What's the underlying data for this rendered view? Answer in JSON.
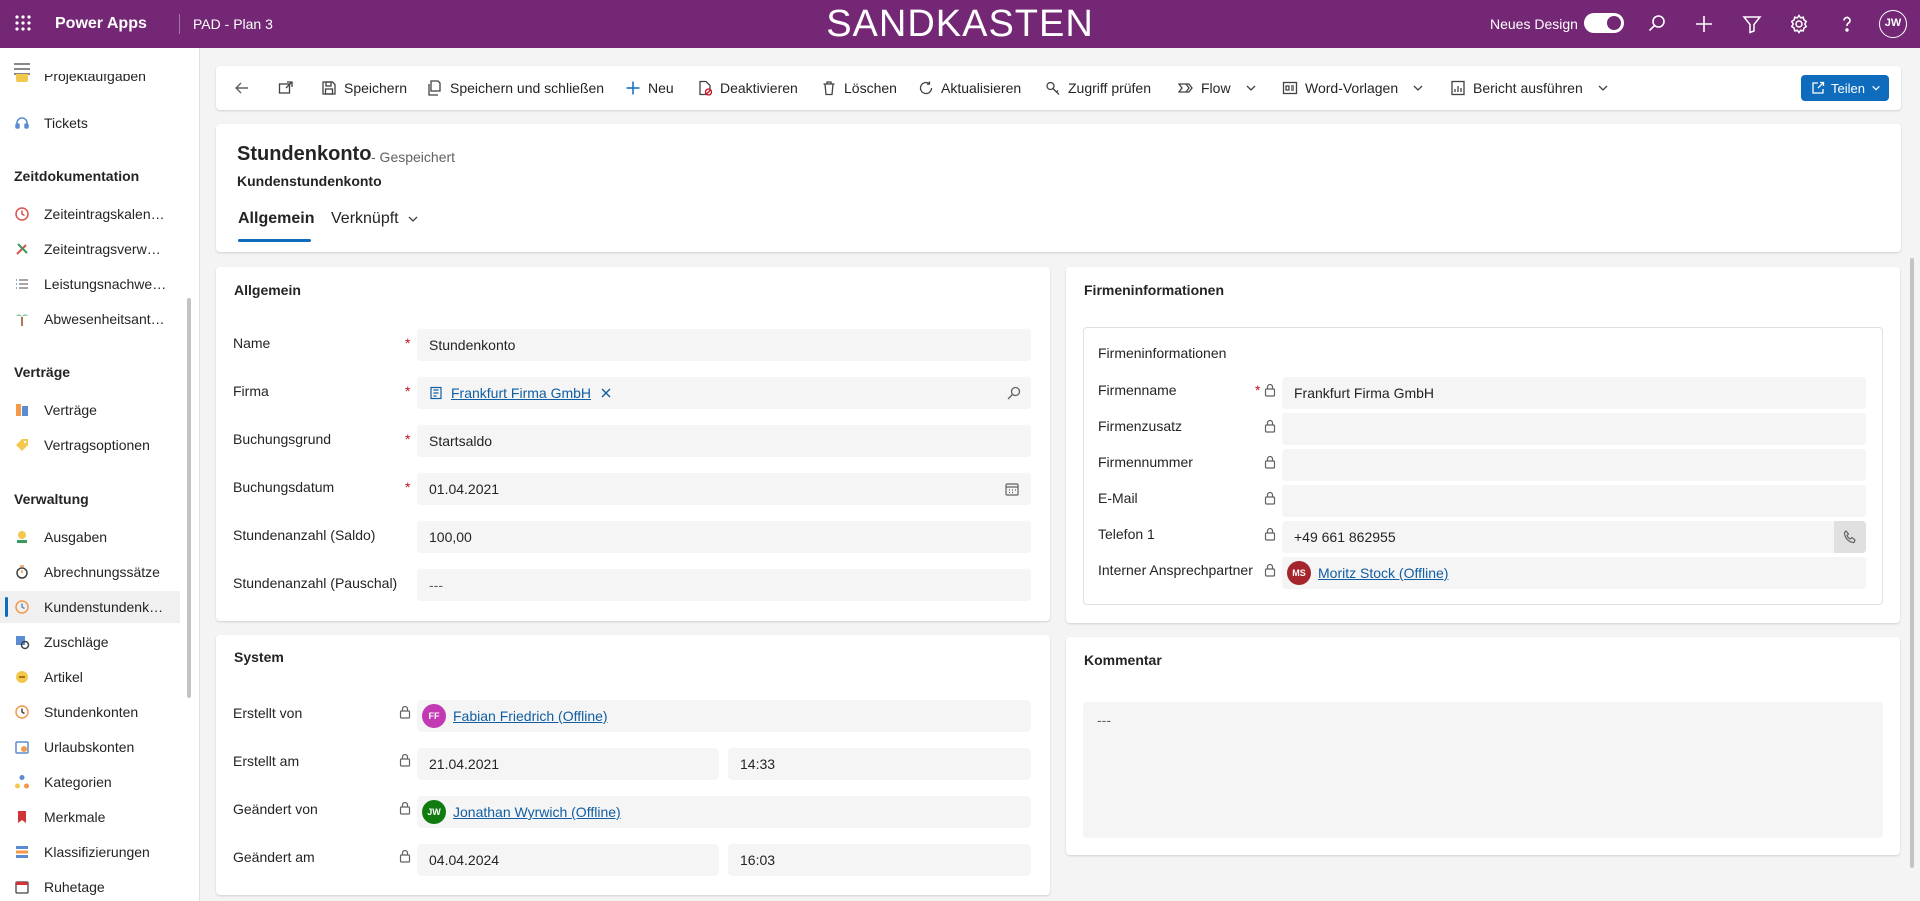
{
  "topbar": {
    "app_name": "Power Apps",
    "env_name": "PAD - Plan 3",
    "banner": "SANDKASTEN",
    "new_design_label": "Neues Design",
    "avatar": "JW"
  },
  "sidebar": {
    "partial_item": "Projektaufgaben",
    "items_top": [
      {
        "label": "Tickets",
        "icon": "headset-icon"
      }
    ],
    "groups": [
      {
        "title": "Zeitdokumentation",
        "items": [
          {
            "label": "Zeiteintragskalender",
            "icon": "clock-icon"
          },
          {
            "label": "Zeiteintragsverwaltung",
            "icon": "tools-icon"
          },
          {
            "label": "Leistungsnachweise",
            "icon": "list-icon"
          },
          {
            "label": "Abwesenheitsanträge",
            "icon": "palm-icon"
          }
        ]
      },
      {
        "title": "Verträge",
        "items": [
          {
            "label": "Verträge",
            "icon": "contract-icon"
          },
          {
            "label": "Vertragsoptionen",
            "icon": "tag-icon"
          }
        ]
      },
      {
        "title": "Verwaltung",
        "items": [
          {
            "label": "Ausgaben",
            "icon": "expense-icon"
          },
          {
            "label": "Abrechnungssätze",
            "icon": "rate-icon"
          },
          {
            "label": "Kundenstundenkonto",
            "icon": "customer-hours-icon"
          },
          {
            "label": "Zuschläge",
            "icon": "surcharge-icon"
          },
          {
            "label": "Artikel",
            "icon": "article-icon"
          },
          {
            "label": "Stundenkonten",
            "icon": "hours-icon"
          },
          {
            "label": "Urlaubskonten",
            "icon": "vacation-icon"
          },
          {
            "label": "Kategorien",
            "icon": "category-icon"
          },
          {
            "label": "Merkmale",
            "icon": "feature-icon"
          },
          {
            "label": "Klassifizierungen",
            "icon": "classification-icon"
          },
          {
            "label": "Ruhetage",
            "icon": "calendar-icon"
          }
        ]
      }
    ]
  },
  "commands": [
    {
      "label": "Speichern"
    },
    {
      "label": "Speichern und schließen"
    },
    {
      "label": "Neu"
    },
    {
      "label": "Deaktivieren"
    },
    {
      "label": "Löschen"
    },
    {
      "label": "Aktualisieren"
    },
    {
      "label": "Zugriff prüfen"
    },
    {
      "label": "Flow"
    },
    {
      "label": "Word-Vorlagen"
    },
    {
      "label": "Bericht ausführen"
    }
  ],
  "share_label": "Teilen",
  "header": {
    "title": "Stundenkonto",
    "status": "- Gespeichert",
    "entity": "Kundenstundenkonto",
    "tabs": [
      "Allgemein",
      "Verknüpft"
    ]
  },
  "general": {
    "title": "Allgemein",
    "fields": [
      {
        "label": "Name",
        "value": "Stundenkonto"
      },
      {
        "label": "Firma",
        "value": "Frankfurt Firma GmbH"
      },
      {
        "label": "Buchungsgrund",
        "value": "Startsaldo"
      },
      {
        "label": "Buchungsdatum",
        "value": "01.04.2021"
      },
      {
        "label": "Stundenanzahl (Saldo)",
        "value": "100,00"
      },
      {
        "label": "Stundenanzahl (Pauschal)",
        "value": "---"
      }
    ]
  },
  "company": {
    "title": "Firmeninformationen",
    "subtitle": "Firmeninformationen",
    "fields": [
      {
        "label": "Firmenname",
        "value": "Frankfurt Firma GmbH"
      },
      {
        "label": "Firmenzusatz",
        "value": ""
      },
      {
        "label": "Firmennummer",
        "value": ""
      },
      {
        "label": "E-Mail",
        "value": ""
      },
      {
        "label": "Telefon 1",
        "value": "+49 661 862955"
      },
      {
        "label": "Interner Ansprechpartner",
        "value": "Moritz Stock (Offline)",
        "initials": "MS"
      }
    ]
  },
  "system": {
    "title": "System",
    "fields": [
      {
        "label": "Erstellt von",
        "value": "Fabian Friedrich (Offline)",
        "initials": "FF"
      },
      {
        "label": "Erstellt am",
        "date": "21.04.2021",
        "time": "14:33"
      },
      {
        "label": "Geändert von",
        "value": "Jonathan Wyrwich (Offline)",
        "initials": "JW"
      },
      {
        "label": "Geändert am",
        "date": "04.04.2024",
        "time": "16:03"
      }
    ]
  },
  "comment": {
    "title": "Kommentar",
    "value": "---"
  },
  "colors": {
    "brand": "#742774",
    "accent": "#0f6cbd",
    "required": "#c50f1f"
  }
}
